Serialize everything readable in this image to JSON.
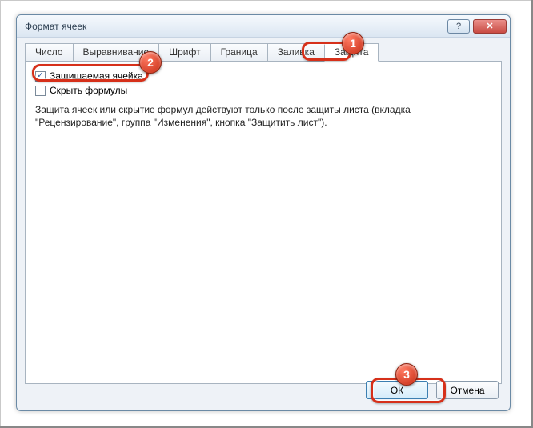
{
  "window": {
    "title": "Формат ячеек"
  },
  "tabs": {
    "items": [
      {
        "label": "Число"
      },
      {
        "label": "Выравнивание"
      },
      {
        "label": "Шрифт"
      },
      {
        "label": "Граница"
      },
      {
        "label": "Заливка"
      },
      {
        "label": "Защита"
      }
    ],
    "activeIndex": 5
  },
  "checkboxes": {
    "locked": {
      "label": "Защищаемая ячейка",
      "checked": true
    },
    "hidden": {
      "label": "Скрыть формулы",
      "checked": false
    }
  },
  "hint": "Защита ячеек или скрытие формул действуют только после защиты листа (вкладка \"Рецензирование\", группа \"Изменения\", кнопка \"Защитить лист\").",
  "buttons": {
    "ok": "ОК",
    "cancel": "Отмена"
  },
  "markers": {
    "m1": "1",
    "m2": "2",
    "m3": "3"
  }
}
